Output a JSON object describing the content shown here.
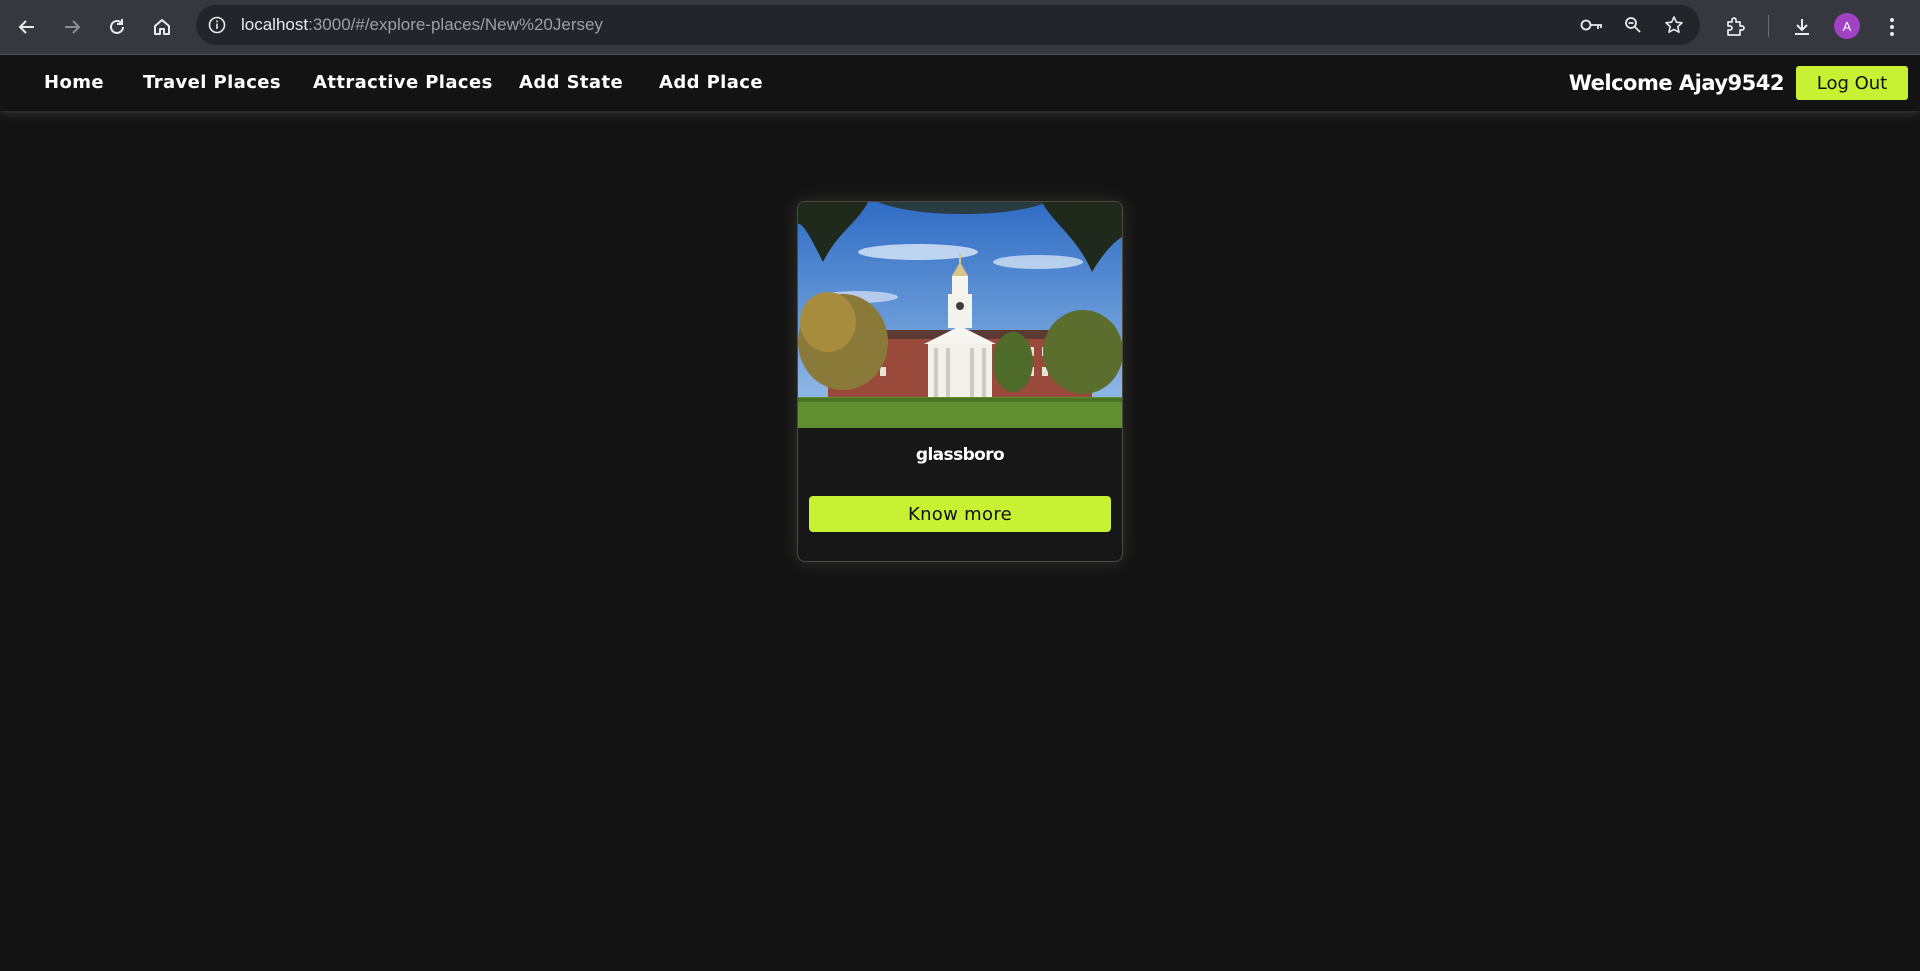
{
  "browser": {
    "url_host": "localhost",
    "url_rest": ":3000/#/explore-places/New%20Jersey",
    "avatar_letter": "A",
    "icons": [
      "back-icon",
      "forward-icon",
      "reload-icon",
      "home-icon",
      "site-info-icon",
      "password-key-icon",
      "zoom-icon",
      "bookmark-star-icon",
      "extensions-icon",
      "download-icon",
      "menu-kebab-icon"
    ]
  },
  "navbar": {
    "links": [
      "Home",
      "Travel Places",
      "Attractive Places",
      "Add State",
      "Add Place"
    ],
    "welcome": "Welcome Ajay9542",
    "logout_label": "Log Out",
    "accent_color": "#c8f134"
  },
  "card": {
    "title": "glassboro",
    "button_label": "Know more",
    "image_subject": "red-brick-hall-with-white-clock-tower"
  },
  "colors": {
    "page_bg": "#131313",
    "accent": "#c8f134",
    "chrome_bg": "#35393f"
  }
}
